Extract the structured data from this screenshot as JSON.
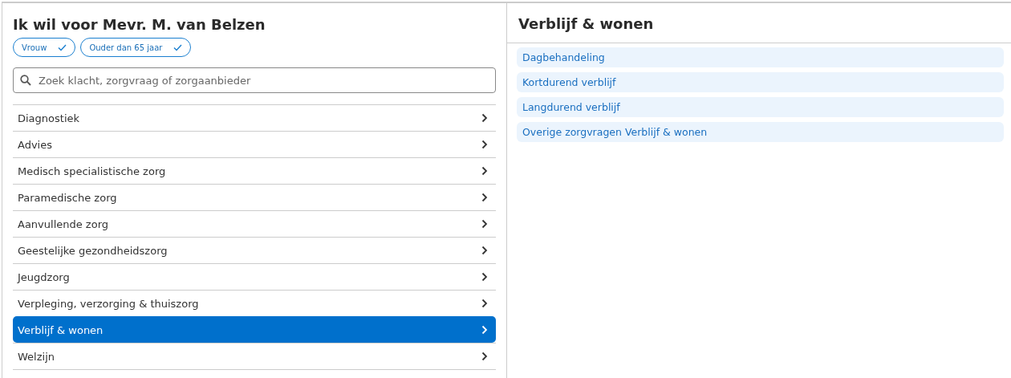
{
  "left_panel": {
    "title": "Ik wil voor Mevr. M. van Belzen",
    "filters": [
      {
        "label": "Vrouw",
        "checked": true
      },
      {
        "label": "Ouder dan 65 jaar",
        "checked": true
      }
    ],
    "search": {
      "placeholder": "Zoek klacht, zorgvraag of zorgaanbieder"
    },
    "categories": [
      {
        "label": "Diagnostiek",
        "selected": false
      },
      {
        "label": "Advies",
        "selected": false
      },
      {
        "label": "Medisch specialistische zorg",
        "selected": false
      },
      {
        "label": "Paramedische zorg",
        "selected": false
      },
      {
        "label": "Aanvullende zorg",
        "selected": false
      },
      {
        "label": "Geestelijke gezondheidszorg",
        "selected": false
      },
      {
        "label": "Jeugdzorg",
        "selected": false
      },
      {
        "label": "Verpleging, verzorging & thuiszorg",
        "selected": false
      },
      {
        "label": "Verblijf & wonen",
        "selected": true
      },
      {
        "label": "Welzijn",
        "selected": false
      }
    ]
  },
  "right_panel": {
    "title": "Verblijf & wonen",
    "items": [
      {
        "label": "Dagbehandeling"
      },
      {
        "label": "Kortdurend verblijf"
      },
      {
        "label": "Langdurend verblijf"
      },
      {
        "label": "Overige zorgvragen Verblijf & wonen"
      }
    ]
  }
}
